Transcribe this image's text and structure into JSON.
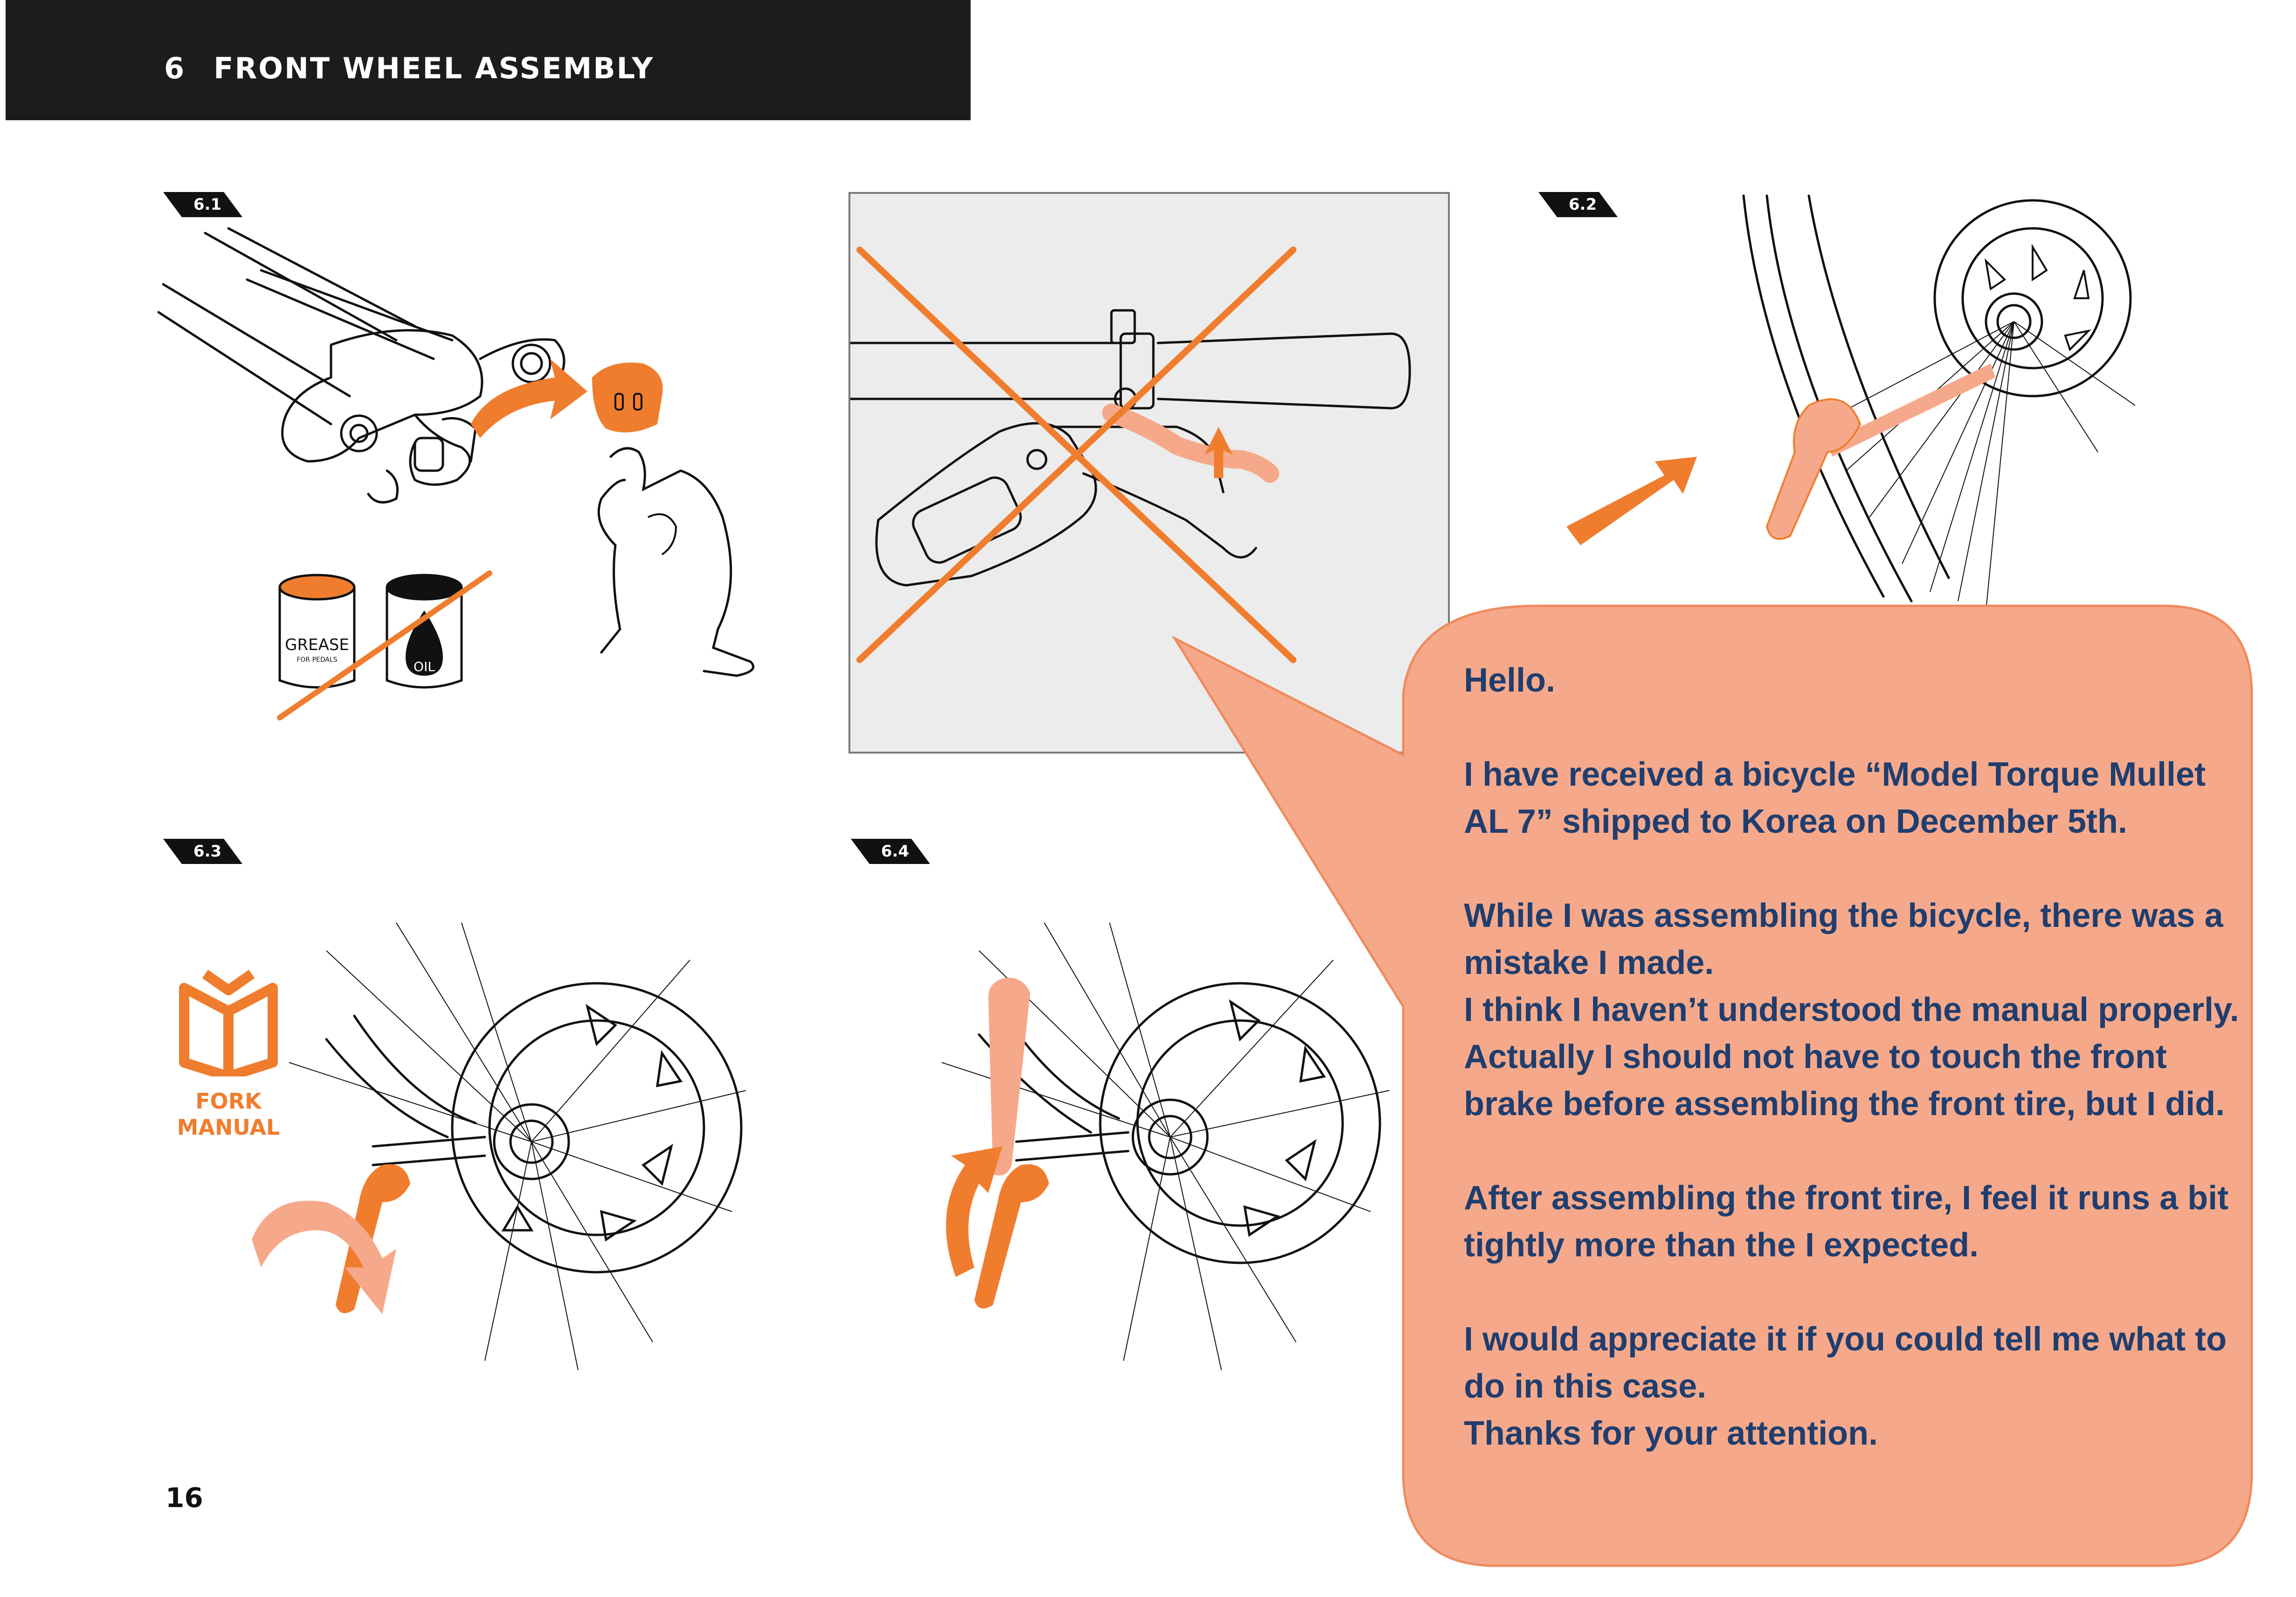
{
  "header": {
    "section_number": "6",
    "section_title": "FRONT WHEEL ASSEMBLY"
  },
  "steps": {
    "step_6_1": "6.1",
    "step_6_2": "6.2",
    "step_6_3": "6.3",
    "step_6_4": "6.4"
  },
  "labels": {
    "grease": "GREASE",
    "grease_sub": "FOR PEDALS",
    "oil": "OIL",
    "fork_manual": "FORK\nMANUAL"
  },
  "page_number": "16",
  "message": {
    "greeting": "Hello.",
    "line_1": "I have received a bicycle “Model Torque Mullet AL 7” shipped to Korea on December 5th.",
    "line_2": "While I was assembling the bicycle, there was a mistake I made.",
    "line_3": "I think I haven’t understood the manual properly. Actually I should not have to touch the front brake before assembling the front tire, but I did.",
    "line_4": "After assembling the front tire, I feel it runs a bit tightly more than the I expected.",
    "line_5": "I would appreciate it if you could tell me what to do in this case.",
    "line_6": "Thanks for your attention."
  },
  "colors": {
    "accent_orange": "#f07d2e",
    "light_orange": "#f6a98a",
    "bubble_fill": "#f6a98a",
    "bubble_stroke": "#ef8a5e",
    "message_text": "#1f3e6f",
    "header_bg": "#1c1c1c"
  },
  "icons": {
    "fork_manual": "open-book-icon",
    "wrong_cross": "cross-out-icon"
  }
}
